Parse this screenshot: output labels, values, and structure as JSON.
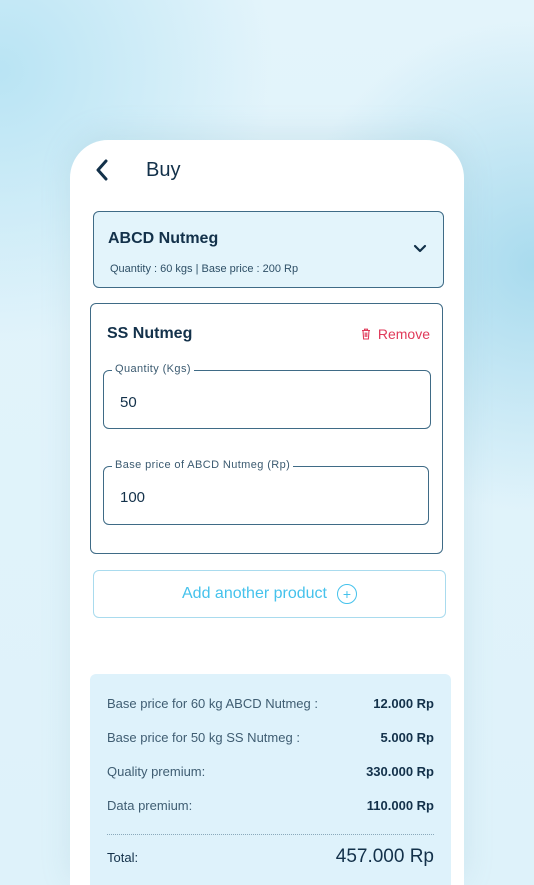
{
  "header": {
    "title": "Buy",
    "back_icon": "chevron-left-icon"
  },
  "selected_product": {
    "name": "ABCD Nutmeg",
    "meta": "Quantity : 60 kgs  |  Base price : 200 Rp",
    "dropdown_icon": "chevron-down-icon"
  },
  "product_item": {
    "name": "SS Nutmeg",
    "remove_label": "Remove",
    "remove_icon": "trash-icon",
    "remove_color": "#e03a5a",
    "quantity_label": "Quantity (Kgs)",
    "quantity_value": "50",
    "price_label": "Base price of ABCD Nutmeg (Rp)",
    "price_value": "100"
  },
  "add_product": {
    "label": "Add another product",
    "icon": "plus-circle-icon",
    "color": "#45c2ec"
  },
  "summary": {
    "rows": [
      {
        "label": "Base price for 60 kg  ABCD Nutmeg :",
        "amount": "12.000 Rp"
      },
      {
        "label": "Base price for 50 kg  SS Nutmeg :",
        "amount": "5.000 Rp"
      },
      {
        "label": "Quality premium:",
        "amount": "330.000 Rp"
      },
      {
        "label": "Data premium:",
        "amount": "110.000 Rp"
      }
    ],
    "total_label": "Total:",
    "total_amount": "457.000 Rp"
  }
}
